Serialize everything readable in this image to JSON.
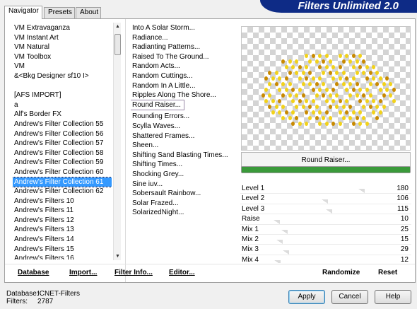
{
  "tabs": [
    "Navigator",
    "Presets",
    "About"
  ],
  "banner_title": "Filters Unlimited 2.0",
  "categories": [
    "VM Extravaganza",
    "VM Instant Art",
    "VM Natural",
    "VM Toolbox",
    "VM",
    "&<Bkg Designer sf10 I>",
    "",
    "[AFS IMPORT]",
    "a",
    "Alf's Border FX",
    "Andrew's Filter Collection 55",
    "Andrew's Filter Collection 56",
    "Andrew's Filter Collection 57",
    "Andrew's Filter Collection 58",
    "Andrew's Filter Collection 59",
    "Andrew's Filter Collection 60",
    "Andrew's Filter Collection 61",
    "Andrew's Filter Collection 62",
    "Andrew's Filters 10",
    "Andrew's Filters 11",
    "Andrew's Filters 12",
    "Andrew's Filters 13",
    "Andrew's Filters 14",
    "Andrew's Filters 15",
    "Andrew's Filters 16"
  ],
  "selected_category": "Andrew's Filter Collection 61",
  "filters": [
    "Into A Solar Storm...",
    "Radiance...",
    "Radianting Patterns...",
    "Raised To The Ground...",
    "Random Acts...",
    "Random Cuttings...",
    "Random In A Little...",
    "Ripples Along The Shore...",
    "Round Raiser...",
    "Rounding Errors...",
    "Scylla Waves...",
    "Shattered Frames...",
    "Sheen...",
    "Shifting Sand Blasting Times...",
    "Shifting Times...",
    "Shocking Grey...",
    "Sine iuv...",
    "Sobersault Rainbow...",
    "Solar Frazed...",
    "SolarizedNight..."
  ],
  "selected_filter": "Round Raiser...",
  "filter_name": "Round Raiser...",
  "progress": 1.0,
  "parameters": [
    {
      "label": "Level 1",
      "value": 180,
      "max": 255
    },
    {
      "label": "Level 2",
      "value": 106,
      "max": 255
    },
    {
      "label": "Level 3",
      "value": 115,
      "max": 255
    },
    {
      "label": "Raise",
      "value": 10,
      "max": 255
    },
    {
      "label": "Mix 1",
      "value": 25,
      "max": 255
    },
    {
      "label": "Mix 2",
      "value": 15,
      "max": 255
    },
    {
      "label": "Mix 3",
      "value": 29,
      "max": 255
    },
    {
      "label": "Mix 4",
      "value": 12,
      "max": 255
    }
  ],
  "commands": {
    "database": "Database",
    "import": "Import...",
    "filter_info": "Filter Info...",
    "editor": "Editor...",
    "randomize": "Randomize",
    "reset": "Reset"
  },
  "info": {
    "database_label": "Database:",
    "database_value": "ICNET-Filters",
    "filters_label": "Filters:",
    "filters_value": "2787"
  },
  "buttons": {
    "apply": "Apply",
    "cancel": "Cancel",
    "help": "Help"
  },
  "colors": {
    "banner": "#0e2b86",
    "selection": "#3399ff",
    "progress": "#3a9a3a"
  }
}
